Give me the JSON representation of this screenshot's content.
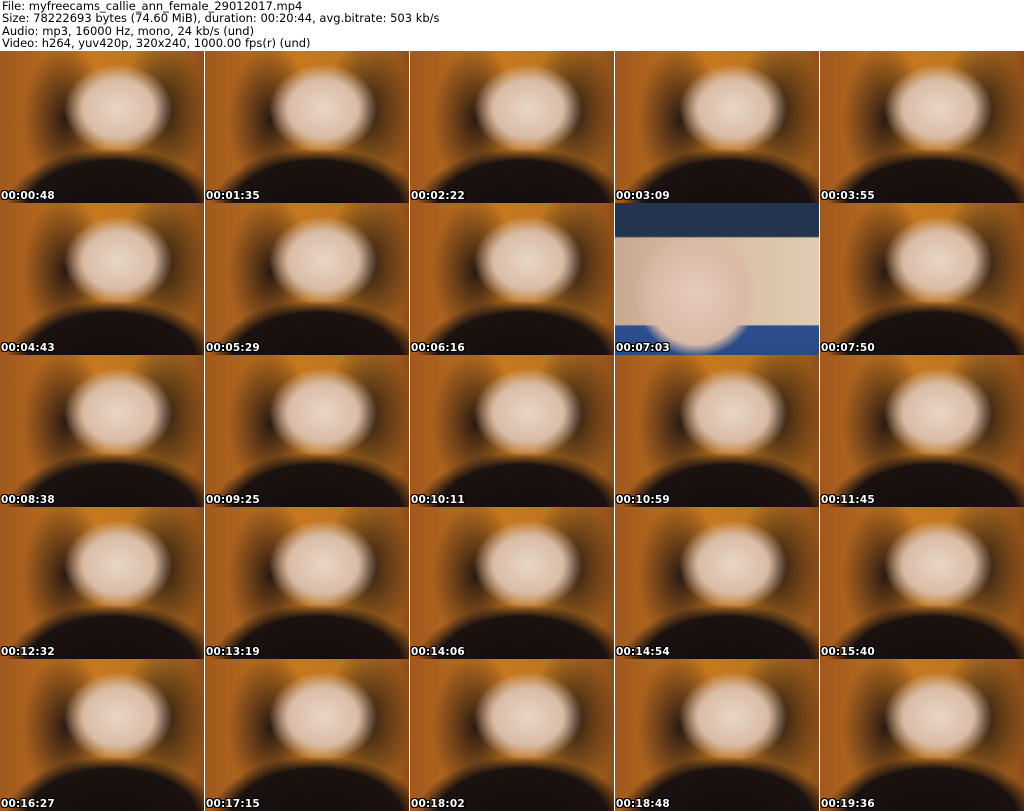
{
  "header": {
    "file": "File: myfreecams_callie_ann_female_29012017.mp4",
    "size": "Size: 78222693 bytes (74.60 MiB), duration: 00:20:44, avg.bitrate: 503 kb/s",
    "audio": "Audio: mp3, 16000 Hz, mono, 24 kb/s (und)",
    "video": "Video: h264, yuv420p, 320x240, 1000.00 fps(r) (und)"
  },
  "thumbnails": [
    {
      "timestamp": "00:00:48"
    },
    {
      "timestamp": "00:01:35"
    },
    {
      "timestamp": "00:02:22"
    },
    {
      "timestamp": "00:03:09"
    },
    {
      "timestamp": "00:03:55"
    },
    {
      "timestamp": "00:04:43"
    },
    {
      "timestamp": "00:05:29"
    },
    {
      "timestamp": "00:06:16"
    },
    {
      "timestamp": "00:07:03"
    },
    {
      "timestamp": "00:07:50"
    },
    {
      "timestamp": "00:08:38"
    },
    {
      "timestamp": "00:09:25"
    },
    {
      "timestamp": "00:10:11"
    },
    {
      "timestamp": "00:10:59"
    },
    {
      "timestamp": "00:11:45"
    },
    {
      "timestamp": "00:12:32"
    },
    {
      "timestamp": "00:13:19"
    },
    {
      "timestamp": "00:14:06"
    },
    {
      "timestamp": "00:14:54"
    },
    {
      "timestamp": "00:15:40"
    },
    {
      "timestamp": "00:16:27"
    },
    {
      "timestamp": "00:17:15"
    },
    {
      "timestamp": "00:18:02"
    },
    {
      "timestamp": "00:18:48"
    },
    {
      "timestamp": "00:19:36"
    }
  ]
}
